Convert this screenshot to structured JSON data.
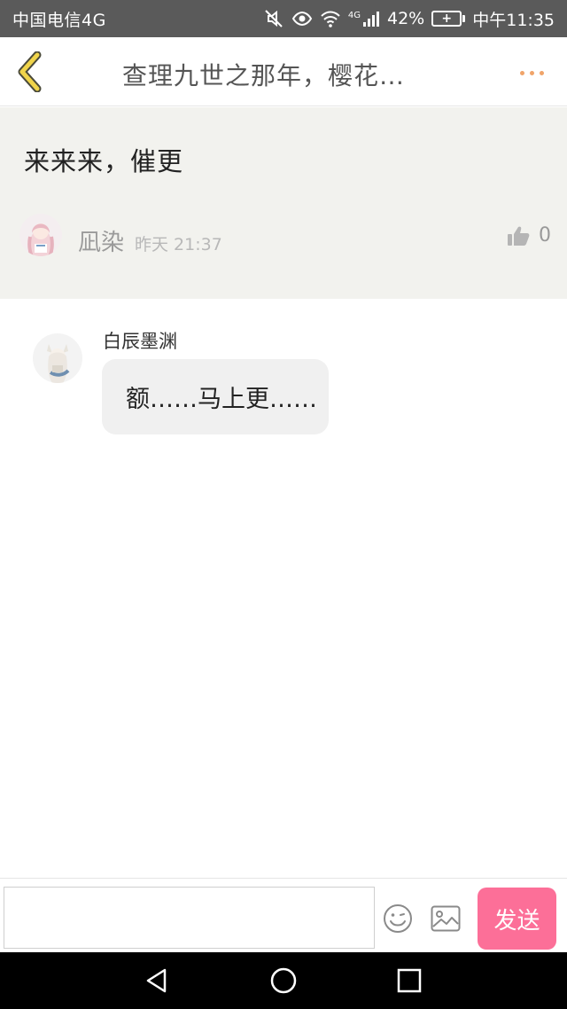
{
  "status_bar": {
    "carrier": "中国电信4G",
    "network_badge": "4G",
    "battery_percent": "42%",
    "time": "中午11:35",
    "icons": [
      "mute-icon",
      "eye-icon",
      "wifi-icon",
      "signal-icon",
      "battery-charging-icon"
    ]
  },
  "header": {
    "title": "查理九世之那年，樱花…",
    "back_icon": "chevron-left-icon",
    "more_icon": "more-dots-icon",
    "accent_color": "#f0a46a"
  },
  "post": {
    "content": "来来来，催更",
    "author": "凪染",
    "time": "昨天 21:37",
    "likes": "0",
    "background": "#f2f2ee"
  },
  "reply": {
    "author": "白辰墨渊",
    "message": "额……马上更……"
  },
  "input_bar": {
    "placeholder": "",
    "send_label": "发送",
    "send_color": "#fc6f98"
  },
  "nav_bar": {
    "buttons": [
      "back-triangle-icon",
      "home-circle-icon",
      "recents-square-icon"
    ]
  }
}
